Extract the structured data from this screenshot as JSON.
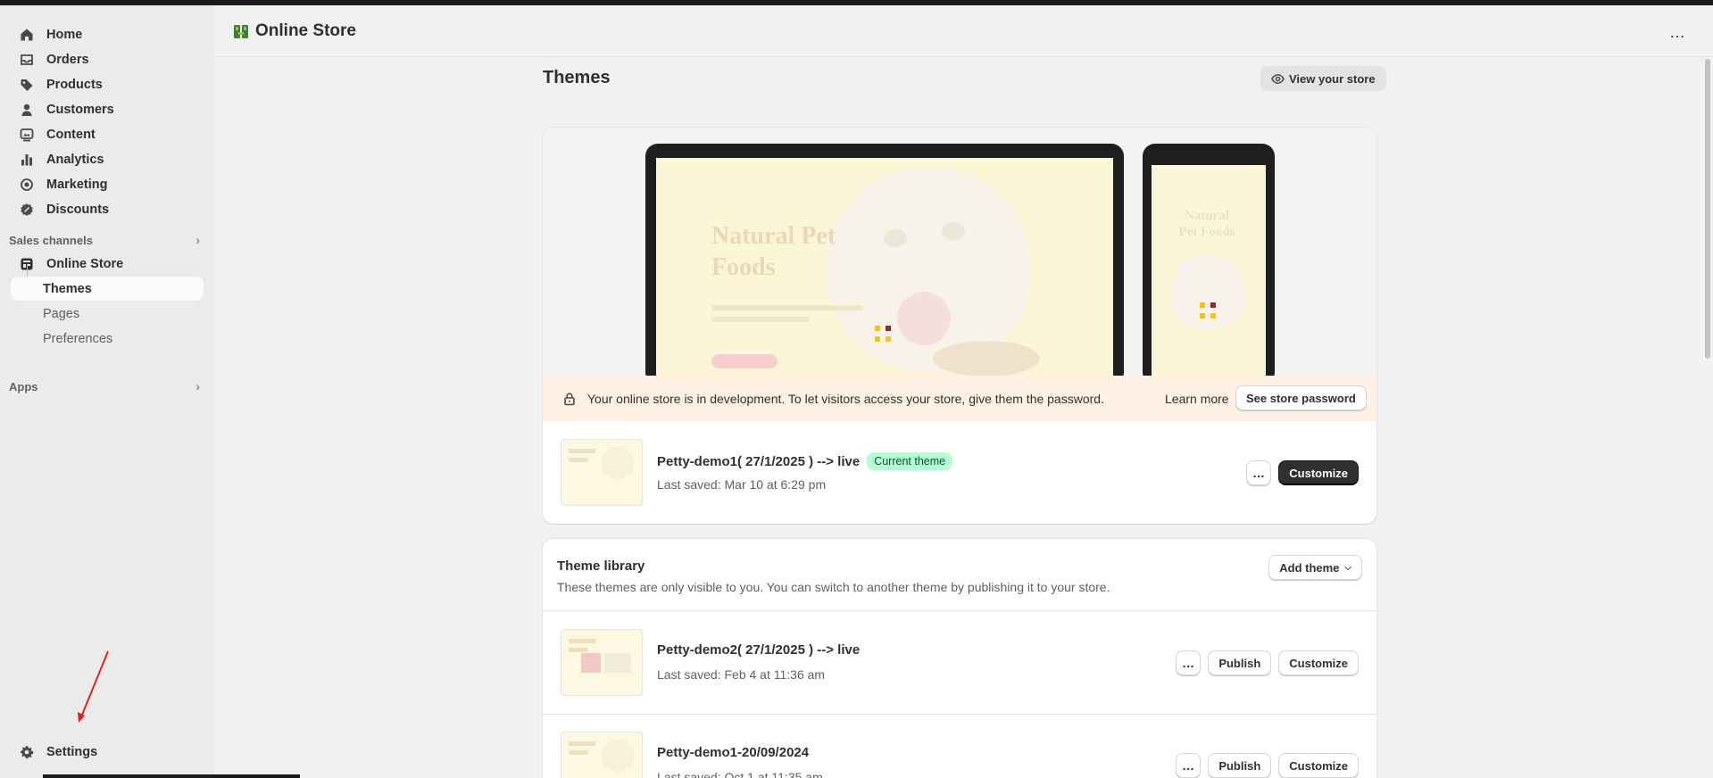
{
  "sidebar": {
    "items": [
      {
        "label": "Home",
        "icon": "home-icon"
      },
      {
        "label": "Orders",
        "icon": "inbox-icon"
      },
      {
        "label": "Products",
        "icon": "tag-icon"
      },
      {
        "label": "Customers",
        "icon": "person-icon"
      },
      {
        "label": "Content",
        "icon": "image-icon"
      },
      {
        "label": "Analytics",
        "icon": "bar-chart-icon"
      },
      {
        "label": "Marketing",
        "icon": "target-icon"
      },
      {
        "label": "Discounts",
        "icon": "discount-icon"
      }
    ],
    "sales_channels_label": "Sales channels",
    "online_store_label": "Online Store",
    "sub_items": [
      {
        "label": "Themes"
      },
      {
        "label": "Pages"
      },
      {
        "label": "Preferences"
      }
    ],
    "apps_label": "Apps",
    "settings_label": "Settings"
  },
  "header": {
    "title": "Online Store",
    "more_label": "…"
  },
  "main": {
    "page_title": "Themes",
    "view_store_label": "View your store",
    "preview": {
      "hero_title": "Natural Pet Foods",
      "hero_title_line1": "Natural Pet",
      "hero_title_line2": "Foods",
      "phone_title_line1": "Natural",
      "phone_title_line2": "Pet Foods"
    },
    "dev_banner": {
      "message": "Your online store is in development. To let visitors access your store, give them the password.",
      "learn_more": "Learn more",
      "password_button": "See store password"
    },
    "current_theme": {
      "name": "Petty-demo1( 27/1/2025 ) --> live",
      "badge": "Current theme",
      "saved": "Last saved: Mar 10 at 6:29 pm",
      "customize": "Customize",
      "more": "…"
    },
    "library": {
      "title": "Theme library",
      "description": "These themes are only visible to you. You can switch to another theme by publishing it to your store.",
      "add_theme": "Add theme",
      "themes": [
        {
          "name": "Petty-demo2( 27/1/2025 ) --> live",
          "saved": "Last saved: Feb 4 at 11:36 am",
          "publish": "Publish",
          "customize": "Customize",
          "more": "…"
        },
        {
          "name": "Petty-demo1-20/09/2024",
          "saved": "Last saved: Oct 1 at 11:35 am",
          "publish": "Publish",
          "customize": "Customize",
          "more": "…"
        }
      ]
    }
  },
  "colors": {
    "accent_dark": "#303030",
    "badge_green": "#b4fed2",
    "banner_bg": "#fff1e3",
    "annotation_red": "#e02424"
  }
}
